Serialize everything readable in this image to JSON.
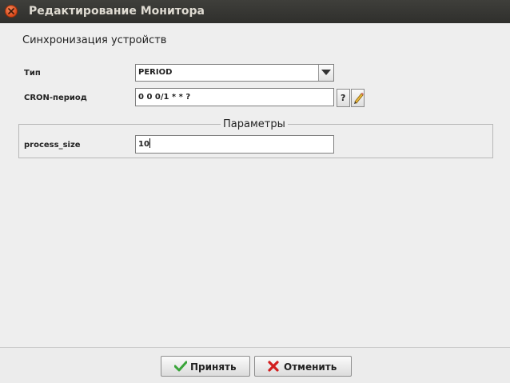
{
  "window": {
    "title": "Редактирование Монитора"
  },
  "form": {
    "section_title": "Синхронизация устройств",
    "type_label": "Тип",
    "type_value": "PERIOD",
    "cron_label": "CRON-период",
    "cron_value": "0 0 0/1 * * ?",
    "help_button_label": "?"
  },
  "params": {
    "title": "Параметры",
    "process_size_label": "process_size",
    "process_size_value": "10"
  },
  "footer": {
    "accept_label": "Принять",
    "cancel_label": "Отменить"
  },
  "colors": {
    "titlebar": "#3c3b37",
    "close_button": "#e95420",
    "accept_icon": "#3aa53a",
    "cancel_icon": "#d21e1e"
  },
  "icons": {
    "close": "close-icon",
    "dropdown": "chevron-down-icon",
    "edit": "pencil-icon",
    "accept": "checkmark-icon",
    "cancel": "x-icon"
  }
}
